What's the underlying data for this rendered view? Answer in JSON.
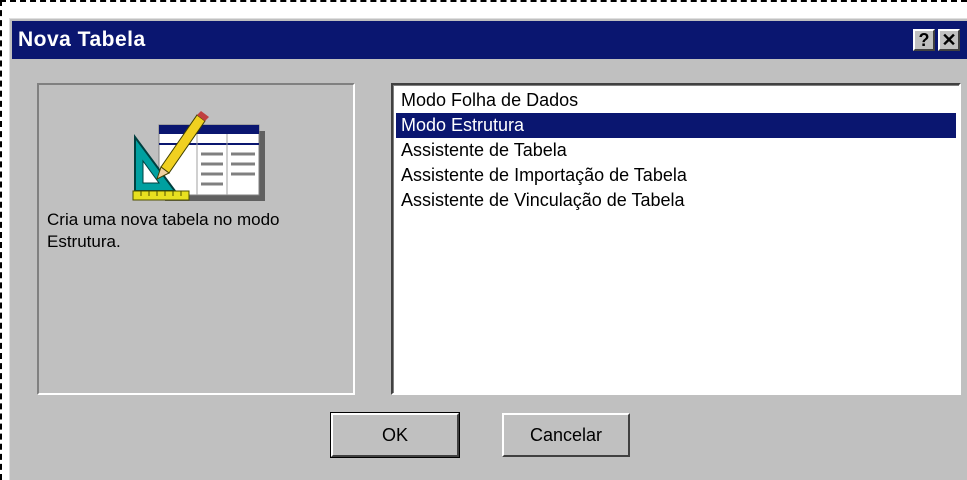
{
  "dialog": {
    "title": "Nova Tabela",
    "help_button": "?",
    "close_button": "✕",
    "preview": {
      "icon": "table-design-icon",
      "description": "Cria uma nova tabela no modo Estrutura."
    },
    "options": [
      "Modo Folha de Dados",
      "Modo Estrutura",
      "Assistente de Tabela",
      "Assistente de Importação de Tabela",
      "Assistente de Vinculação de Tabela"
    ],
    "selected_option": "Modo Estrutura",
    "ok_label": "OK",
    "cancel_label": "Cancelar"
  },
  "colors": {
    "titlebar": "#0a1670",
    "face": "#c0c0c0",
    "selection": "#0a1670"
  }
}
